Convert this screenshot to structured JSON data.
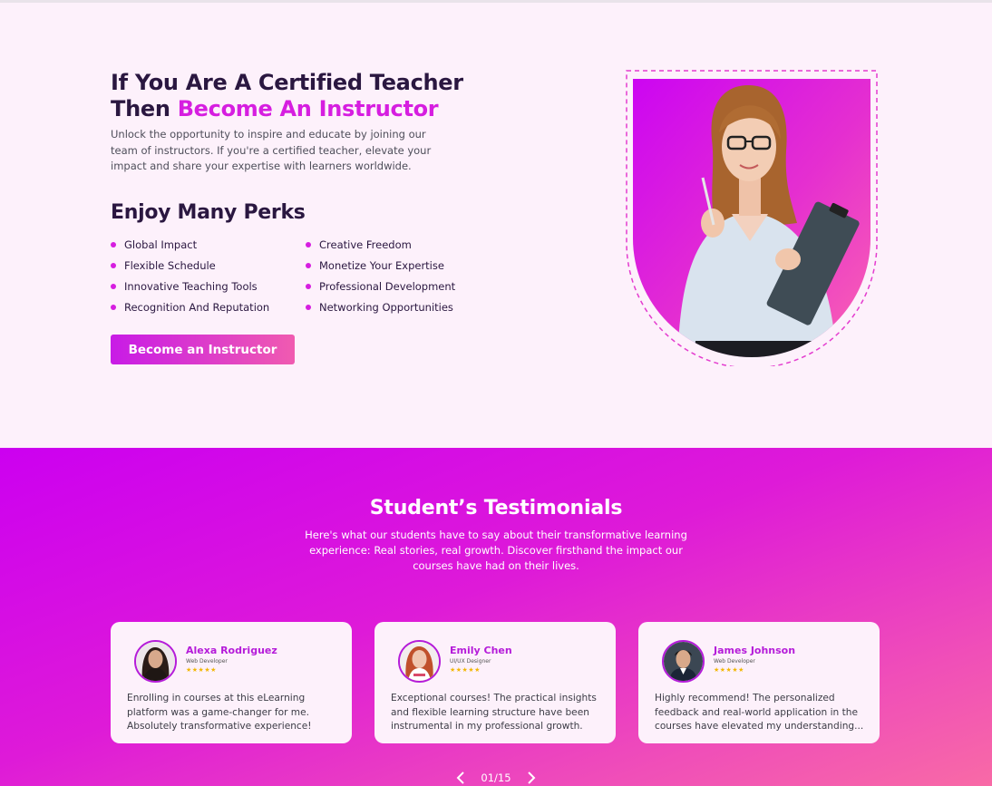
{
  "instructor": {
    "headline_line1": "If You Are A Certified Teacher",
    "headline_line2_prefix": "Then ",
    "headline_line2_accent": "Become An Instructor",
    "intro": "Unlock the opportunity to inspire and educate by joining our team of instructors. If you're a certified teacher, elevate your impact and share your expertise with learners worldwide.",
    "perks_title": "Enjoy Many Perks",
    "perks": [
      "Global Impact",
      "Creative Freedom",
      "Flexible Schedule",
      "Monetize Your Expertise",
      "Innovative Teaching Tools",
      "Professional Development",
      "Recognition And Reputation",
      "Networking Opportunities"
    ],
    "cta_label": "Become an Instructor",
    "accent_color": "#d61ee0"
  },
  "testimonials": {
    "title": "Student’s Testimonials",
    "subtitle": "Here's what our students have to say about their transformative learning experience: Real stories, real growth. Discover firsthand the impact our courses have had on their lives.",
    "cards": [
      {
        "name": "Alexa Rodriguez",
        "role": "Web Developer",
        "stars": "★★★★★",
        "text": "Enrolling in courses at this eLearning platform was a game-changer for me. Absolutely transformative experience!"
      },
      {
        "name": "Emily Chen",
        "role": "UI/UX Designer",
        "stars": "★★★★★",
        "text": "Exceptional courses! The practical insights and flexible learning structure have been instrumental in my professional growth."
      },
      {
        "name": "James Johnson",
        "role": "Web Developer",
        "stars": "★★★★★",
        "text": "Highly recommend! The personalized feedback and real-world application in the courses have elevated my understanding..."
      }
    ],
    "pager": "01/15"
  }
}
